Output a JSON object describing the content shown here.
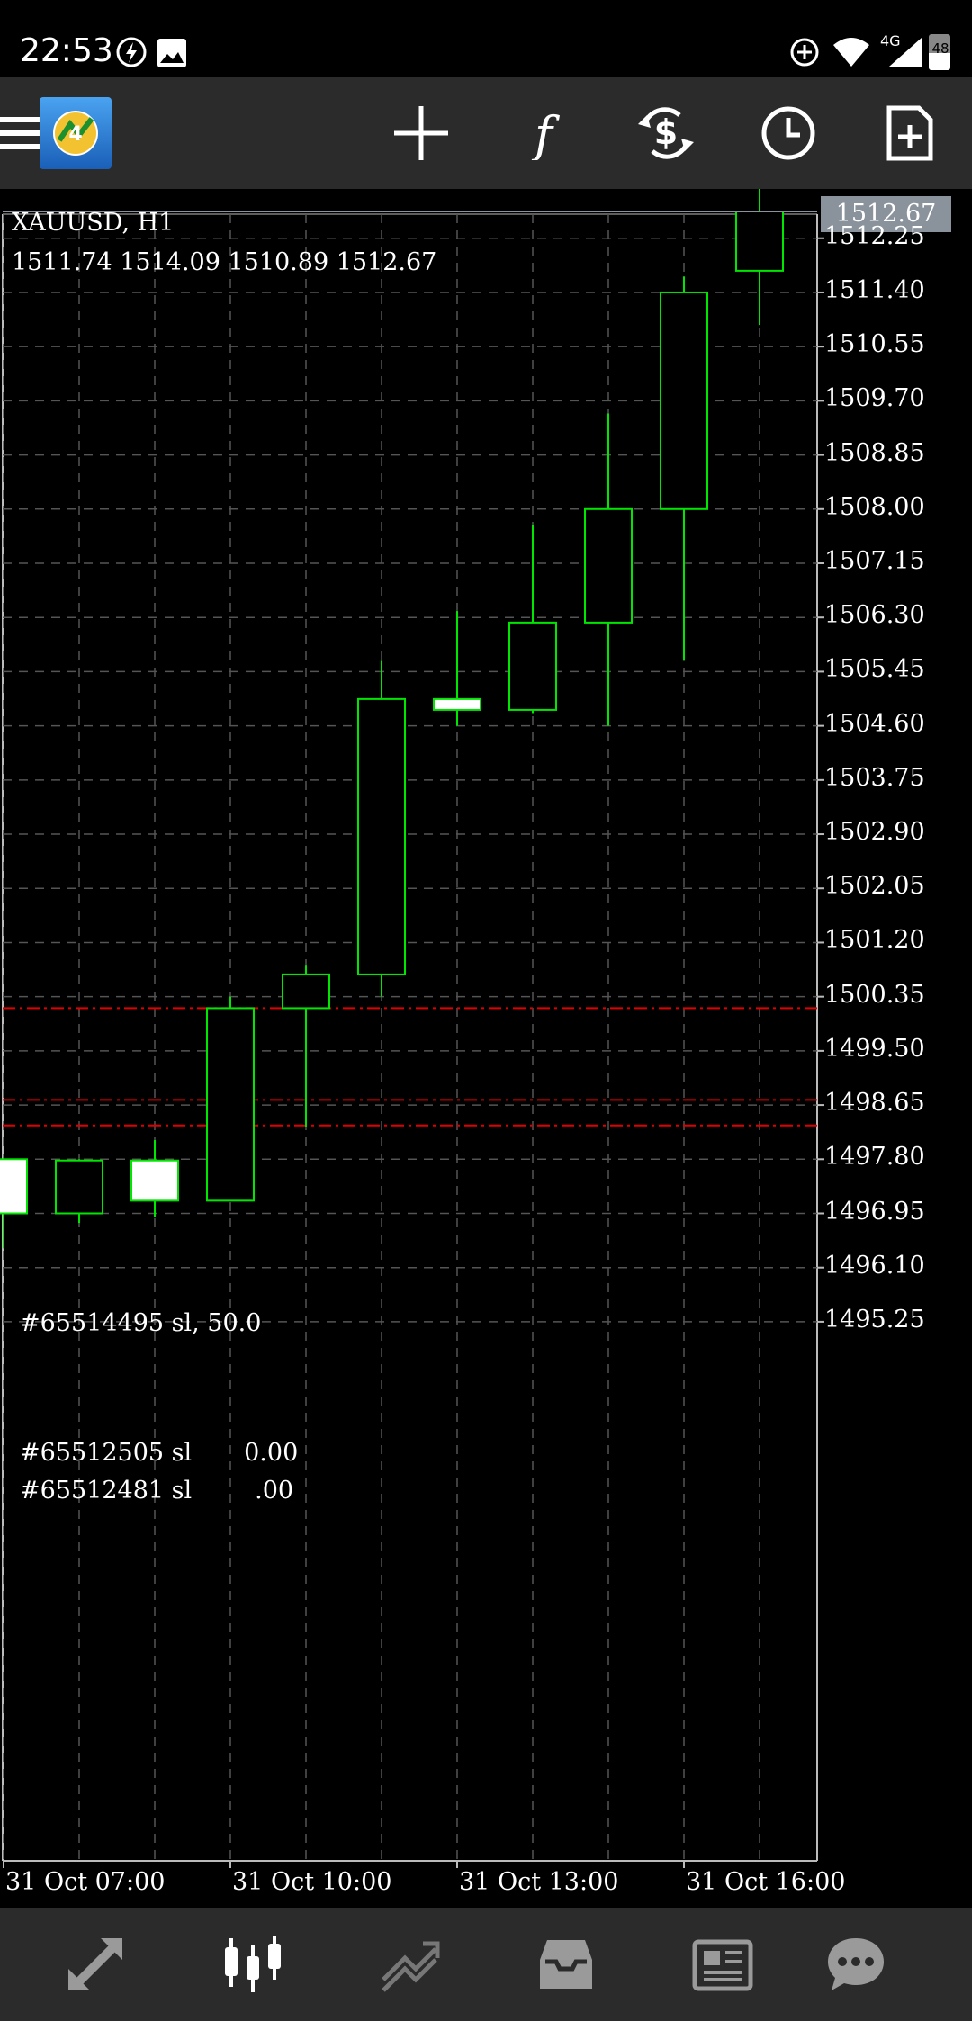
{
  "status_bar": {
    "time": "22:53",
    "network": "4G",
    "battery": "48",
    "icons": [
      "flash-icon",
      "image-icon",
      "sync-icon",
      "wifi-icon",
      "signal-icon",
      "battery-icon"
    ]
  },
  "toolbar": {
    "icons": [
      "menu-icon",
      "metatrader-logo-icon",
      "crosshair-icon",
      "function-f-icon",
      "trade-dollar-icon",
      "timeframe-clock-icon",
      "new-document-icon"
    ]
  },
  "chart": {
    "symbol": "XAUUSD, H1",
    "ohlc": "1511.74 1514.09 1510.89 1512.67",
    "current_price": "1512.67",
    "background": "#000000",
    "candle_color": "#00e600",
    "grid_color": "#555555",
    "order_line_color": "#e00000",
    "y_ticks": [
      "1512.25",
      "1511.40",
      "1510.55",
      "1509.70",
      "1508.85",
      "1508.00",
      "1507.15",
      "1506.30",
      "1505.45",
      "1504.60",
      "1503.75",
      "1502.90",
      "1502.05",
      "1501.20",
      "1500.35",
      "1499.50",
      "1498.65",
      "1497.80",
      "1496.95",
      "1496.10",
      "1495.25"
    ],
    "x_ticks": [
      "31 Oct 07:00",
      "31 Oct 10:00",
      "31 Oct 13:00",
      "31 Oct 16:00"
    ],
    "orders": [
      {
        "label": "#65514495 sl, 50.0",
        "price": 1500.17
      },
      {
        "label": "#65512505 sl",
        "suffix": "0.00",
        "price": 1498.73
      },
      {
        "label": "#65512481 sl",
        "suffix": ".00",
        "price": 1498.33
      }
    ]
  },
  "chart_data": {
    "type": "candlestick",
    "title": "XAUUSD, H1",
    "x_ticks": [
      "31 Oct 07:00",
      "31 Oct 10:00",
      "31 Oct 13:00",
      "31 Oct 16:00"
    ],
    "ylim": [
      1494.7,
      1512.9
    ],
    "candles": [
      {
        "open": 1497.8,
        "high": 1497.8,
        "low": 1496.4,
        "close": 1496.95,
        "bull": false
      },
      {
        "open": 1496.95,
        "high": 1497.8,
        "low": 1496.8,
        "close": 1497.78,
        "bull": true
      },
      {
        "open": 1497.78,
        "high": 1498.1,
        "low": 1496.9,
        "close": 1497.15,
        "bull": false
      },
      {
        "open": 1497.15,
        "high": 1500.35,
        "low": 1497.15,
        "close": 1500.17,
        "bull": true
      },
      {
        "open": 1500.17,
        "high": 1500.85,
        "low": 1498.3,
        "close": 1500.7,
        "bull": true
      },
      {
        "open": 1500.7,
        "high": 1505.62,
        "low": 1500.35,
        "close": 1505.02,
        "bull": true
      },
      {
        "open": 1505.02,
        "high": 1506.4,
        "low": 1504.6,
        "close": 1504.85,
        "bull": false
      },
      {
        "open": 1504.85,
        "high": 1507.75,
        "low": 1504.8,
        "close": 1506.22,
        "bull": true
      },
      {
        "open": 1506.22,
        "high": 1509.5,
        "low": 1504.6,
        "close": 1508.0,
        "bull": true
      },
      {
        "open": 1508.0,
        "high": 1511.65,
        "low": 1505.62,
        "close": 1511.4,
        "bull": true
      },
      {
        "open": 1511.74,
        "high": 1514.09,
        "low": 1510.89,
        "close": 1512.67,
        "bull": true
      }
    ]
  },
  "bottom_nav": {
    "items": [
      {
        "name": "nav-quotes",
        "icon": "quotes-arrows-icon"
      },
      {
        "name": "nav-chart",
        "icon": "candlestick-chart-icon",
        "active": true
      },
      {
        "name": "nav-trade",
        "icon": "trade-trend-icon"
      },
      {
        "name": "nav-history",
        "icon": "inbox-history-icon"
      },
      {
        "name": "nav-news",
        "icon": "news-icon"
      },
      {
        "name": "nav-chat",
        "icon": "chat-bubble-icon"
      }
    ]
  }
}
